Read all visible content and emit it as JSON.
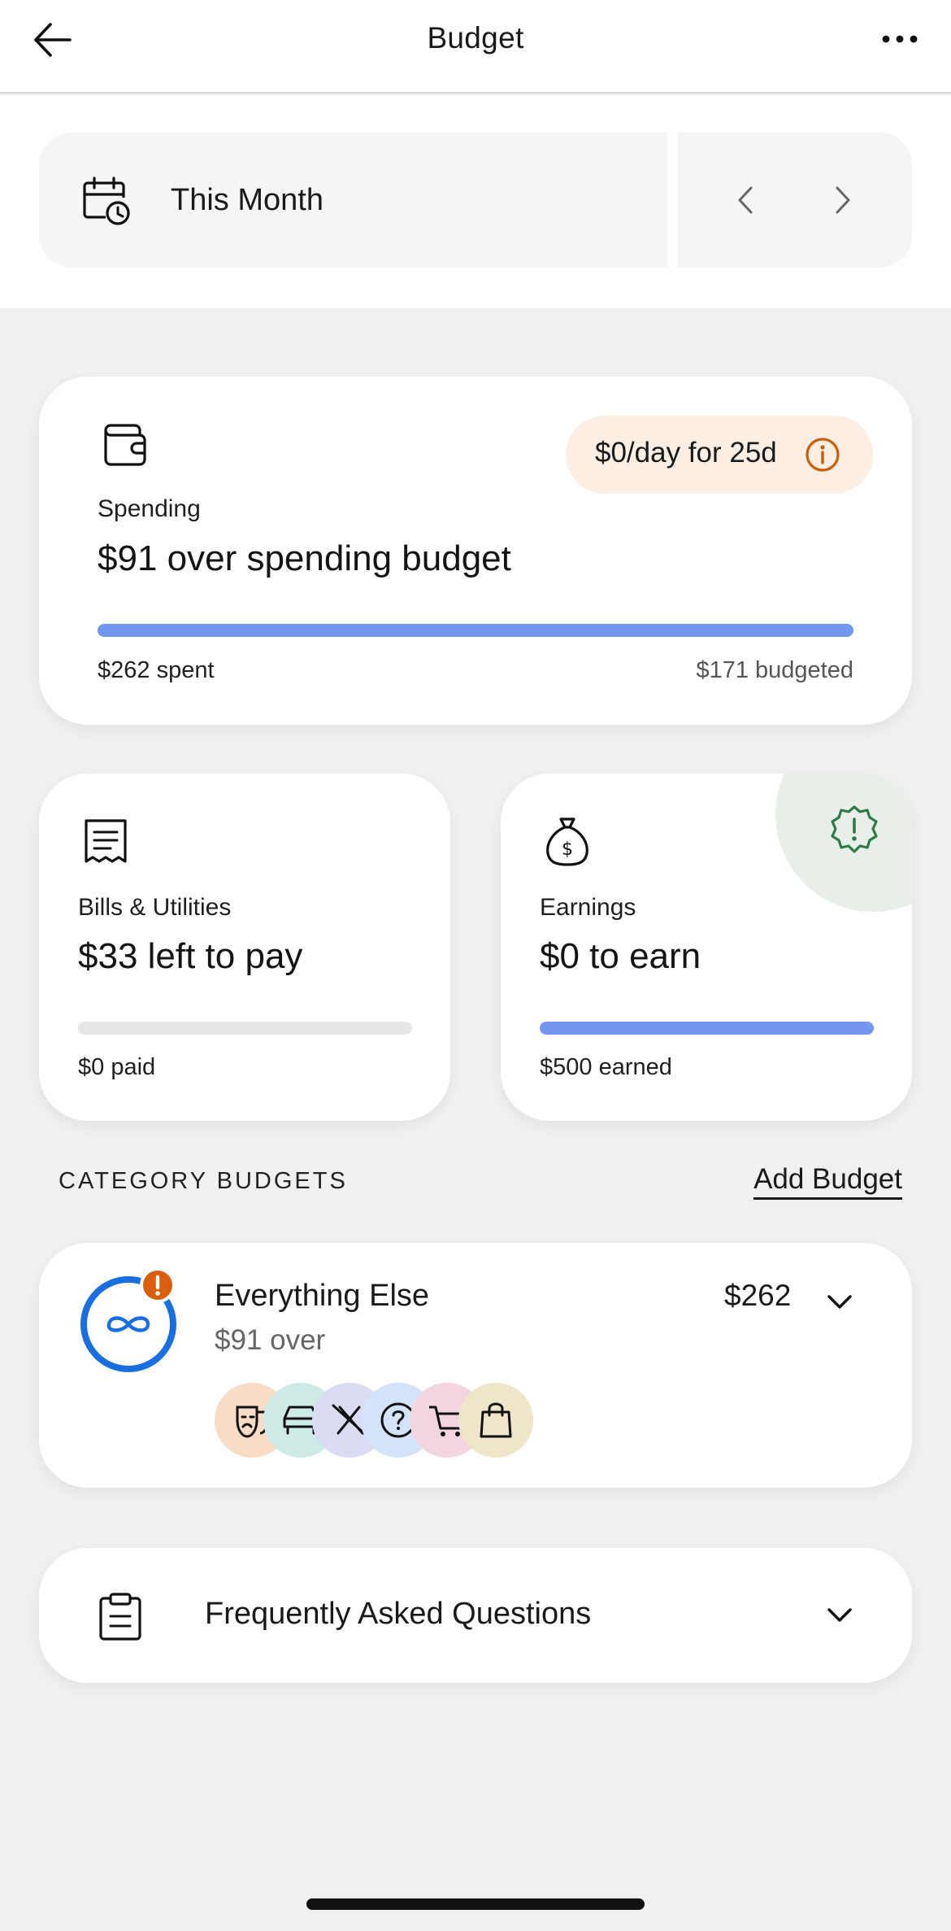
{
  "header": {
    "title": "Budget",
    "back_icon": "arrow-left-icon",
    "more_icon": "more-horizontal-icon"
  },
  "period": {
    "label": "This Month",
    "icon": "calendar-clock-icon"
  },
  "spending": {
    "icon": "wallet-icon",
    "label": "Spending",
    "headline": "$91 over spending budget",
    "pill_text": "$0/day for 25d",
    "spent": "$262 spent",
    "budgeted": "$171 budgeted",
    "progress": 1.0,
    "bar_color": "#7396ee",
    "pill_color": "#fdeee4",
    "info_color": "#c7600b"
  },
  "bills": {
    "icon": "receipt-icon",
    "label": "Bills & Utilities",
    "headline": "$33 left to pay",
    "paid": "$0 paid",
    "progress": 0.0
  },
  "earnings": {
    "icon": "money-bag-icon",
    "alert_icon": "alert-badge-icon",
    "label": "Earnings",
    "headline": "$0 to earn",
    "earned": "$500 earned",
    "progress": 1.0,
    "alert_color": "#2f7a46"
  },
  "category_budgets": {
    "section_title": "CATEGORY BUDGETS",
    "add_label": "Add Budget",
    "items": [
      {
        "name": "Everything Else",
        "status": "$91 over",
        "amount": "$262",
        "ring_color": "#1a6fe0",
        "alert_color": "#d95f0e",
        "category_icons": [
          {
            "icon": "theater-masks-icon",
            "color": "#f8dcc6"
          },
          {
            "icon": "car-icon",
            "color": "#cdeae6"
          },
          {
            "icon": "no-utensils-icon",
            "color": "#d9dcf3"
          },
          {
            "icon": "question-circle-icon",
            "color": "#d3e4f8"
          },
          {
            "icon": "shopping-cart-icon",
            "color": "#f1d6e1"
          },
          {
            "icon": "shopping-bag-icon",
            "color": "#efe6c9"
          }
        ]
      }
    ]
  },
  "faq": {
    "label": "Frequently Asked Questions",
    "icon": "clipboard-icon"
  }
}
